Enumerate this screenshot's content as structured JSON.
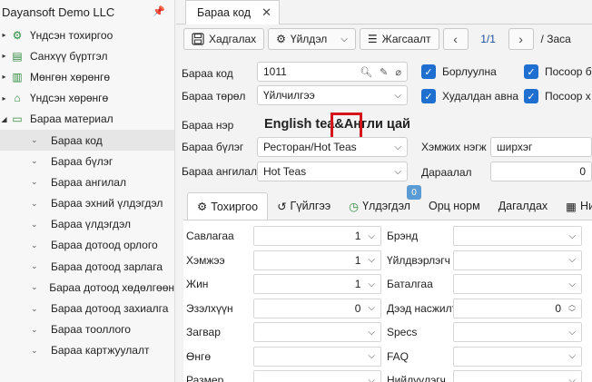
{
  "sidebar": {
    "title": "Dayansoft Demo LLC",
    "items": [
      {
        "label": "Үндсэн тохиргоо",
        "icon": "gear-icon"
      },
      {
        "label": "Санхүү бүртгэл",
        "icon": "ledger-icon"
      },
      {
        "label": "Мөнгөн хөрөнгө",
        "icon": "money-icon"
      },
      {
        "label": "Үндсэн хөрөнгө",
        "icon": "building-icon"
      },
      {
        "label": "Бараа материал",
        "icon": "inventory-icon"
      }
    ],
    "subitems": [
      "Бараа код",
      "Бараа бүлэг",
      "Бараа ангилал",
      "Бараа эхний үлдэгдэл",
      "Бараа үлдэгдэл",
      "Бараа дотоод орлого",
      "Бараа дотоод зарлага",
      "Бараа дотоод хөдөлгөөн",
      "Бараа дотоод захиалга",
      "Бараа тооллого",
      "Бараа картжуулалт"
    ]
  },
  "tab": {
    "label": "Бараа код"
  },
  "toolbar": {
    "save": "Хадгалах",
    "action": "Үйлдэл",
    "list": "Жагсаалт",
    "pager": "1/1",
    "tail": "/ Заса"
  },
  "form": {
    "code_label": "Бараа код",
    "code_value": "1011",
    "type_label": "Бараа төрөл",
    "type_value": "Үйлчилгээ",
    "name_label": "Бараа нэр",
    "name_value": "English tea&Англи цай",
    "group_label": "Бараа бүлэг",
    "group_value": "Ресторан/Hot Teas",
    "category_label": "Бараа ангилал",
    "category_value": "Hot Teas",
    "unit_label": "Хэмжих нэгж",
    "unit_value": "ширхэг",
    "order_label": "Дараалал",
    "order_value": "0",
    "chk_sale": "Борлуулна",
    "chk_buy": "Худалдан авна",
    "chk_pos1": "Посоор б",
    "chk_pos2": "Посоор х"
  },
  "subtabs": {
    "settings": "Тохиргоо",
    "transactions": "Гүйлгээ",
    "balance": "Үлдэгдэл",
    "balance_badge": "0",
    "recipe": "Орц норм",
    "accompany": "Дагалдах",
    "more": "Ни"
  },
  "grid": {
    "left": [
      {
        "label": "Савлагаа",
        "value": "1",
        "kind": "select"
      },
      {
        "label": "Хэмжээ",
        "value": "1",
        "kind": "select"
      },
      {
        "label": "Жин",
        "value": "1",
        "kind": "select"
      },
      {
        "label": "Эзэлхүүн",
        "value": "0",
        "kind": "select"
      },
      {
        "label": "Загвар",
        "value": "",
        "kind": "select"
      },
      {
        "label": "Өнгө",
        "value": "",
        "kind": "select"
      },
      {
        "label": "Размер",
        "value": "",
        "kind": "select"
      }
    ],
    "right": [
      {
        "label": "Брэнд",
        "value": "",
        "kind": "select"
      },
      {
        "label": "Үйлдвэрлэгч",
        "value": "",
        "kind": "select"
      },
      {
        "label": "Баталгаа",
        "value": "",
        "kind": "select"
      },
      {
        "label": "Дээд насжилт",
        "value": "0",
        "kind": "spin"
      },
      {
        "label": "Specs",
        "value": "",
        "kind": "select"
      },
      {
        "label": "FAQ",
        "value": "",
        "kind": "select"
      },
      {
        "label": "Нийлүүлэгч",
        "value": "",
        "kind": "select"
      }
    ]
  }
}
